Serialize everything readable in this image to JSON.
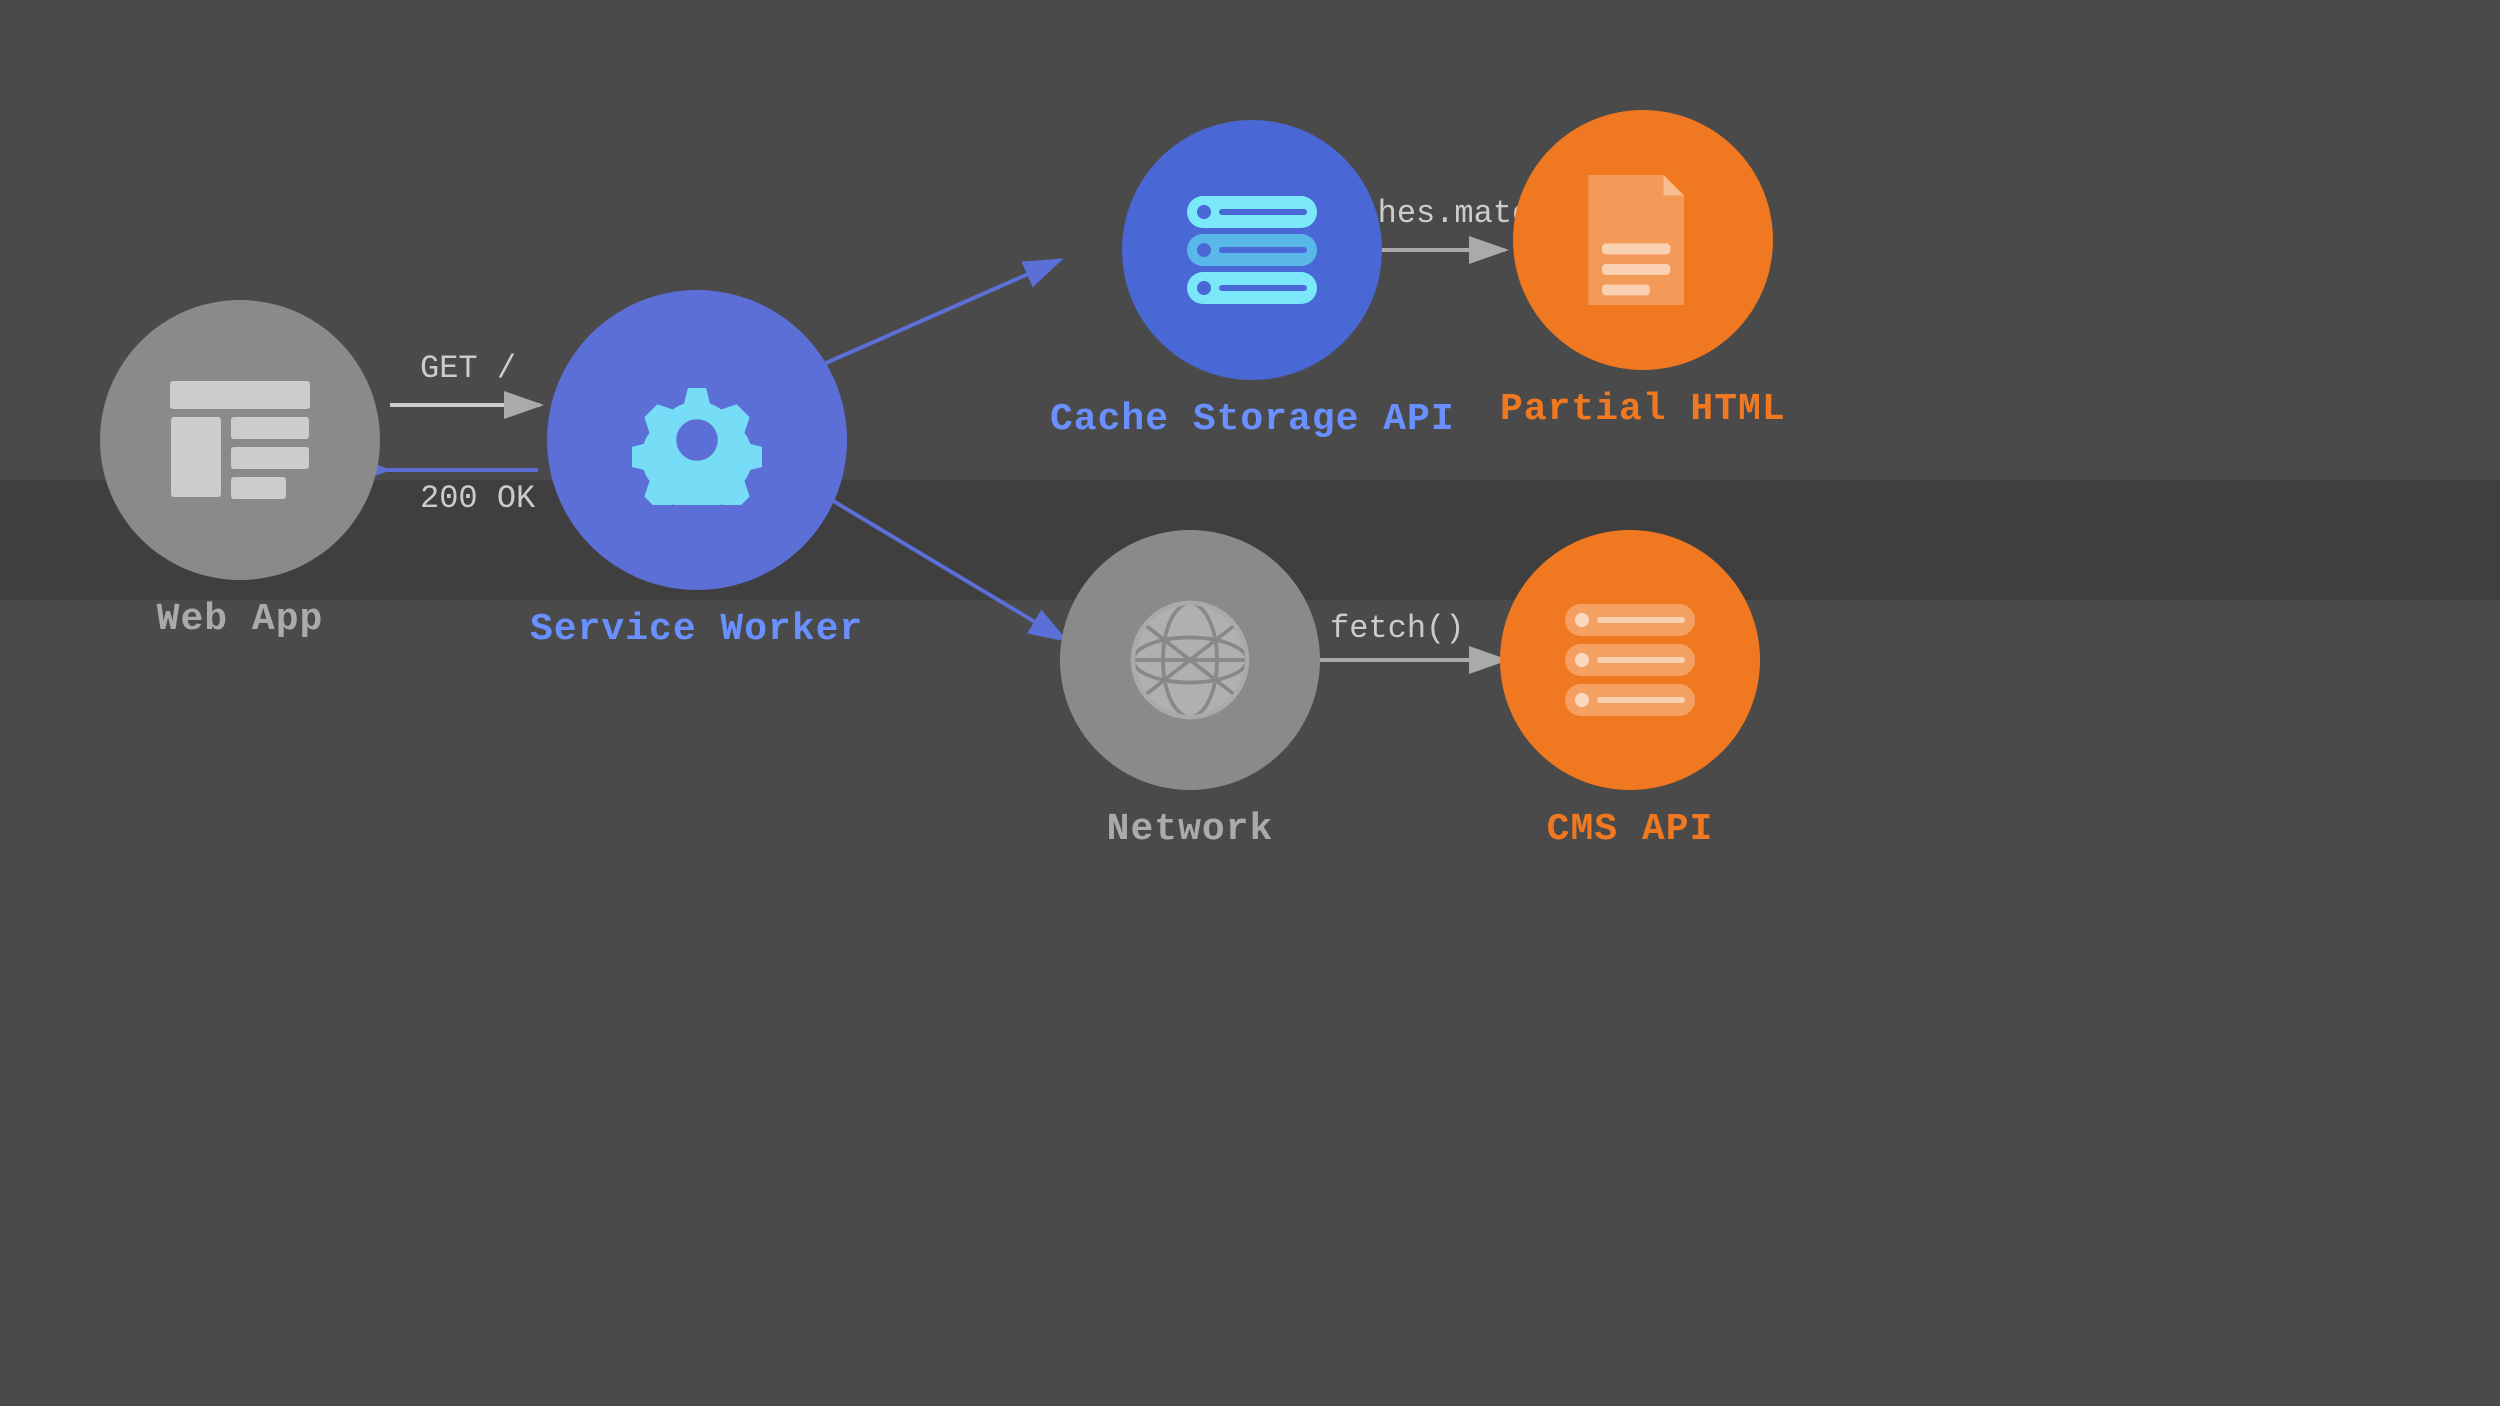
{
  "background": "#4a4a4a",
  "nodes": {
    "webApp": {
      "label": "Web App",
      "color": "#aaaaaa"
    },
    "serviceWorker": {
      "label": "Service Worker",
      "color": "#6a8fff"
    },
    "cacheApi": {
      "label": "Cache Storage API",
      "color": "#6a8fff"
    },
    "network": {
      "label": "Network",
      "color": "#aaaaaa"
    },
    "partialHtml": {
      "label": "Partial HTML",
      "color": "#f07820"
    },
    "cmsApi": {
      "label": "CMS API",
      "color": "#f07820"
    }
  },
  "arrows": {
    "getRequest": "GET /",
    "response": "200 OK",
    "cachesMatch": "caches.match()",
    "fetch": "fetch()"
  }
}
